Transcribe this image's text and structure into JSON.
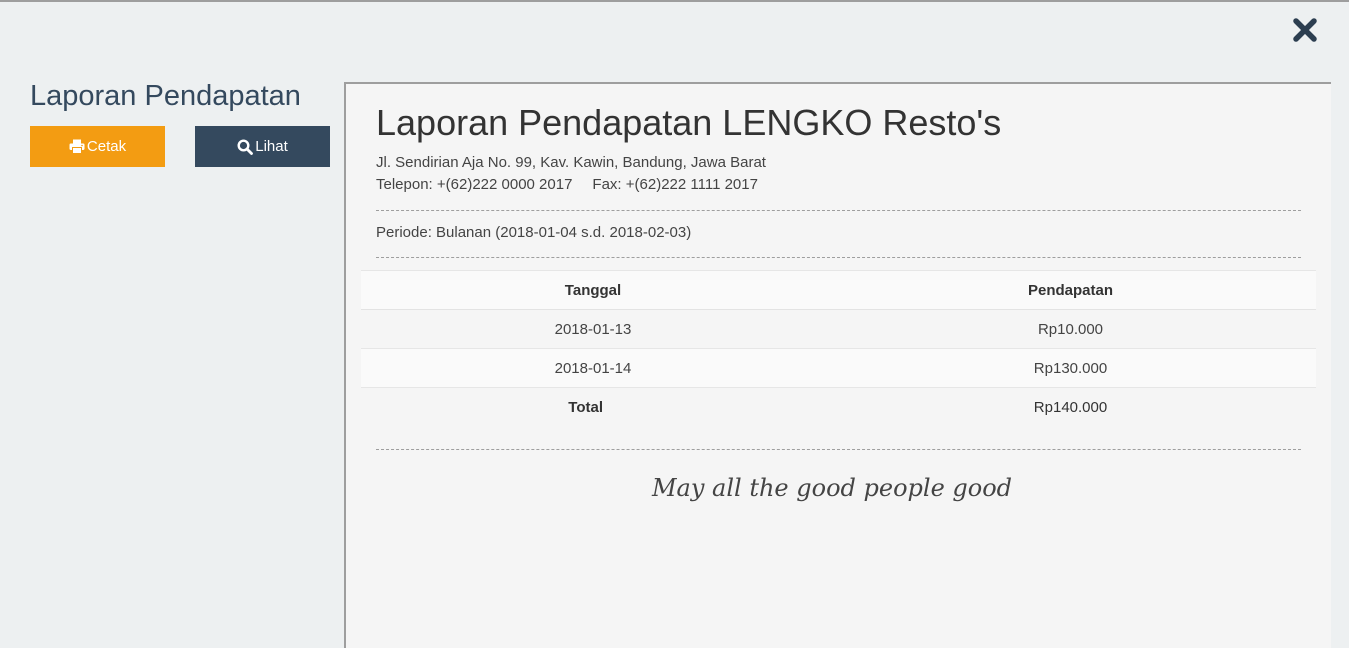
{
  "header": {
    "title": "Laporan Pendapatan"
  },
  "toolbar": {
    "print_label": "Cetak",
    "view_label": "Lihat"
  },
  "colors": {
    "print_button": "#f39c12",
    "view_button": "#34495e",
    "page_background": "#edf0f1",
    "report_background": "#f5f5f5"
  },
  "report": {
    "title": "Laporan Pendapatan LENGKO Resto's",
    "address": "Jl. Sendirian Aja No. 99, Kav. Kawin, Bandung, Jawa Barat",
    "phone": "Telepon: +(62)222 0000 2017",
    "fax": "Fax: +(62)222 1111 2017",
    "period": "Periode: Bulanan (2018-01-04 s.d. 2018-02-03)",
    "table": {
      "headers": [
        "Tanggal",
        "Pendapatan"
      ],
      "rows": [
        {
          "date": "2018-01-13",
          "income": "Rp10.000"
        },
        {
          "date": "2018-01-14",
          "income": "Rp130.000"
        }
      ],
      "total_label": "Total",
      "total_value": "Rp140.000"
    },
    "footer_note": "May all the good people good"
  },
  "icons": {
    "close": "close-icon",
    "print": "print-icon",
    "search": "search-icon"
  }
}
